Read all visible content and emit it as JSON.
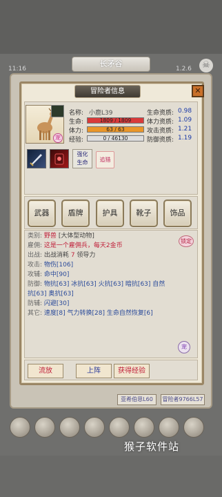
{
  "background": {
    "location_title": "长矛谷",
    "time": "11:16",
    "version": "1.2.6",
    "bottom_tabs": [
      "亚希伯恩L60",
      "冒险者9766L57"
    ]
  },
  "watermark": "猴子软件站",
  "dialog": {
    "title": "冒险者信息",
    "close_icon": "✕",
    "portrait_badge": "宠",
    "stats": {
      "name_label": "名称:",
      "name_value": "小鹿L39",
      "hp_label": "生命:",
      "hp_text": "1809 / 1809",
      "hp_fraction": 1.0,
      "stamina_label": "体力:",
      "stamina_text": "63 / 63",
      "stamina_fraction": 1.0,
      "exp_label": "经验:",
      "exp_text": "0 / 46130",
      "exp_fraction": 0.0,
      "hp_apt_label": "生命资质:",
      "hp_apt_value": "0.98",
      "stamina_apt_label": "体力资质:",
      "stamina_apt_value": "1.09",
      "atk_apt_label": "攻击资质:",
      "atk_apt_value": "1.21",
      "def_apt_label": "防御资质:",
      "def_apt_value": "1.19"
    },
    "skills": {
      "enhance_label": "强化\n生命",
      "chase_label": "追猎"
    },
    "equipment_tabs": [
      "武器",
      "盾牌",
      "护具",
      "靴子",
      "饰品"
    ],
    "details": {
      "category_key": "类别:",
      "category_val": "野兽",
      "category_extra": "[大体型动物]",
      "hire_key": "雇佣:",
      "hire_val": "这是一个雇佣兵，每天2金币",
      "battle_key": "出战:",
      "battle_val": "出战消耗",
      "battle_num": "7",
      "battle_tail": "领导力",
      "atk_key": "攻击:",
      "atk_val": "物伤[106]",
      "aux_key": "攻辅:",
      "aux_val": "命中[90]",
      "def_key": "防御:",
      "def_val_1": "物抗[63] 冰抗[63] 火抗[63] 暗抗[63] 自然",
      "def_val_2": "抗[63] 奥抗[63]",
      "defaux_key": "防辅:",
      "defaux_val": "闪避[30]",
      "other_key": "其它:",
      "other_val": "速度[8] 气力转换[28] 生命自然恢复[6]",
      "lock_badge": "锁定",
      "pet_badge": "宠"
    },
    "actions": {
      "release": "流放",
      "deploy": "上阵",
      "gain_exp": "获得经验"
    }
  },
  "colors": {
    "hp_bar": "#d93a3a",
    "stamina_bar": "#e9962a",
    "exp_bar": "#e0e0e0",
    "accent_red": "#c0203a",
    "accent_blue": "#1a3aa8"
  }
}
